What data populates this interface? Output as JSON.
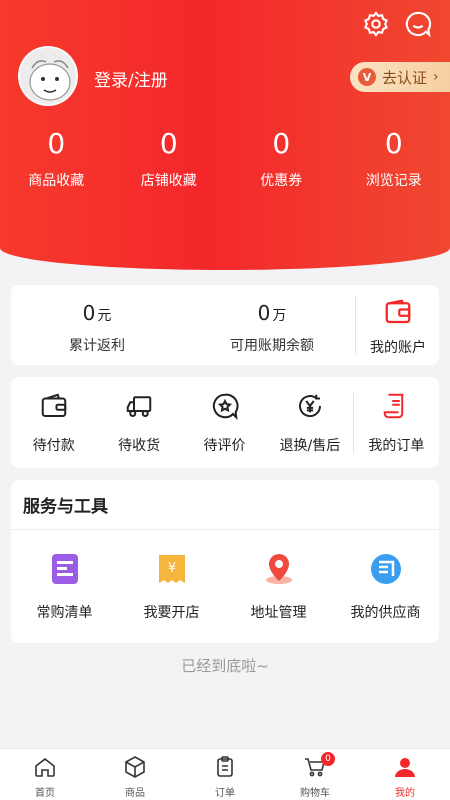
{
  "header": {
    "login_label": "登录/注册",
    "cert_label": "去认证",
    "cert_badge": "V",
    "stats": [
      {
        "num": "0",
        "label": "商品收藏"
      },
      {
        "num": "0",
        "label": "店铺收藏"
      },
      {
        "num": "0",
        "label": "优惠券"
      },
      {
        "num": "0",
        "label": "浏览记录"
      }
    ]
  },
  "wallet": {
    "rebate_value": "0",
    "rebate_unit": "元",
    "rebate_label": "累计返利",
    "credit_value": "0",
    "credit_unit": "万",
    "credit_label": "可用账期余额",
    "account_label": "我的账户"
  },
  "orders": [
    {
      "label": "待付款",
      "icon": "wallet-icon"
    },
    {
      "label": "待收货",
      "icon": "truck-icon"
    },
    {
      "label": "待评价",
      "icon": "review-icon"
    },
    {
      "label": "退换/售后",
      "icon": "refund-icon"
    },
    {
      "label": "我的订单",
      "icon": "order-list-icon"
    }
  ],
  "services": {
    "title": "服务与工具",
    "items": [
      {
        "label": "常购清单",
        "icon": "list-icon"
      },
      {
        "label": "我要开店",
        "icon": "shop-icon"
      },
      {
        "label": "地址管理",
        "icon": "location-icon"
      },
      {
        "label": "我的供应商",
        "icon": "supplier-icon"
      }
    ]
  },
  "footer_text": "已经到底啦~",
  "tabbar": [
    {
      "label": "首页"
    },
    {
      "label": "商品"
    },
    {
      "label": "订单"
    },
    {
      "label": "购物车",
      "badge": "0"
    },
    {
      "label": "我的"
    }
  ],
  "colors": {
    "brand_red": "#f4272b",
    "service_purple": "#9b5de5",
    "service_yellow": "#f6b53c",
    "service_blue": "#3a9df0"
  }
}
